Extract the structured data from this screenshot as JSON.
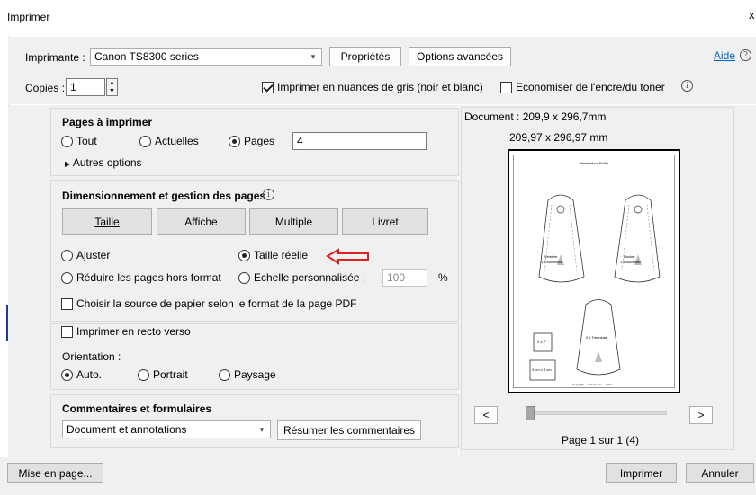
{
  "window": {
    "title": "Imprimer",
    "close": "x"
  },
  "printer": {
    "label": "Imprimante :",
    "selected": "Canon TS8300 series",
    "properties_button": "Propriétés",
    "advanced_button": "Options avancées",
    "help_link": "Aide",
    "help_icon": "question-icon"
  },
  "copies": {
    "label": "Copies :",
    "value": "1",
    "grayscale_label": "Imprimer en nuances de gris (noir et blanc)",
    "grayscale_checked": true,
    "save_ink_label": "Economiser de l'encre/du toner",
    "save_ink_checked": false
  },
  "pages": {
    "heading": "Pages à imprimer",
    "all": "Tout",
    "current": "Actuelles",
    "pages": "Pages",
    "selected": "pages",
    "pages_value": "4",
    "more_options": "Autres options"
  },
  "sizing": {
    "heading": "Dimensionnement et gestion des pages",
    "buttons": [
      "Taille",
      "Affiche",
      "Multiple",
      "Livret"
    ],
    "fit": "Ajuster",
    "actual_size": "Taille réelle",
    "shrink": "Réduire les pages hors format",
    "custom_scale": "Echelle personnalisée :",
    "scale_value": "100",
    "percent": "%",
    "selected": "actual_size",
    "paper_source": "Choisir la source de papier selon le format de la page PDF",
    "paper_source_checked": false
  },
  "duplex": {
    "label": "Imprimer en recto verso",
    "checked": false,
    "orientation_label": "Orientation :",
    "auto": "Auto.",
    "portrait": "Portrait",
    "landscape": "Paysage",
    "selected": "auto"
  },
  "comments": {
    "heading": "Commentaires et formulaires",
    "selected": "Document et annotations",
    "summarize_button": "Résumer les commentaires"
  },
  "preview": {
    "document_size": "Document : 209,9 x 296,7mm",
    "page_size": "209,97 x 296,97 mm",
    "prev_button": "<",
    "next_button": ">",
    "page_indicator": "Page 1 sur 1 (4)",
    "slider_position": 0,
    "thumb": {
      "header_text": "Verteilerbox Roller",
      "tag1_label": "Verteiler",
      "tag1_sub": "1 x Außenteil",
      "tag2_label": "Rocket",
      "tag2_sub": "1 x Außenteil",
      "tag3_label": "2 x Trennblatt",
      "box1_label": "2 x 2\"",
      "box2_label": "3 cm x 3 cm",
      "footer_text": "Copyright ... Verteilerbox ... Roller ..."
    }
  },
  "footer": {
    "page_setup_button": "Mise en page...",
    "print_button": "Imprimer",
    "cancel_button": "Annuler"
  },
  "colors": {
    "annotation_arrow": "#e02020",
    "link": "#0066cc",
    "panel_bg": "#f0f0f0"
  }
}
